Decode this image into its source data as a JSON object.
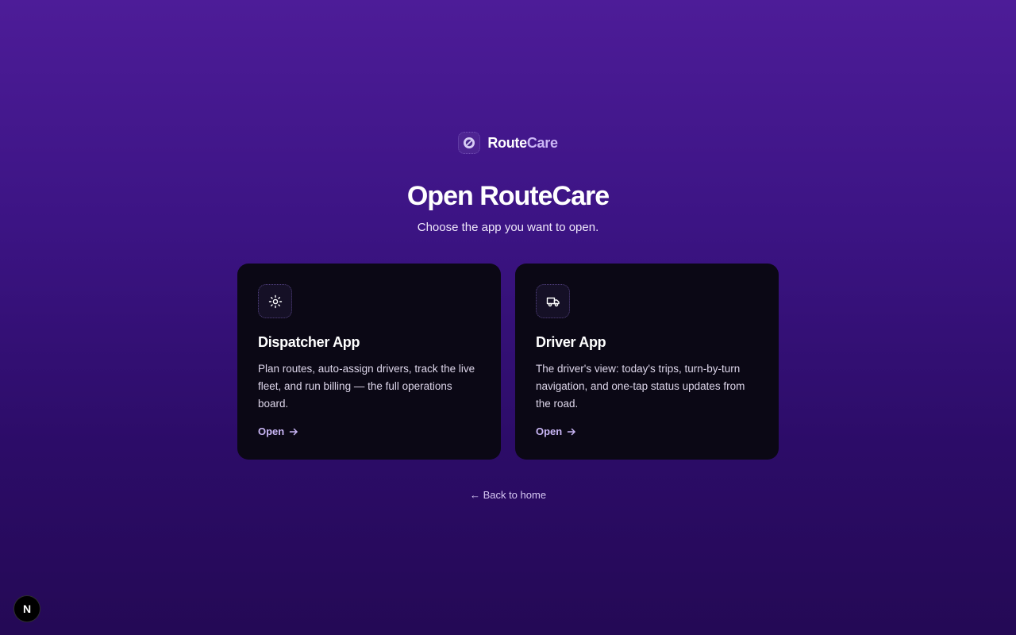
{
  "brand": {
    "logo_icon": "map-pin-shield-icon",
    "name_part1": "Route",
    "name_part2": "Care"
  },
  "page": {
    "title": "Open RouteCare",
    "subtitle": "Choose the app you want to open."
  },
  "cards": [
    {
      "icon": "sun-gear-icon",
      "title": "Dispatcher App",
      "description": "Plan routes, auto-assign drivers, track the live fleet, and run billing — the full operations board.",
      "link_label": "Open",
      "link_icon": "arrow-right-icon"
    },
    {
      "icon": "truck-icon",
      "title": "Driver App",
      "description": "The driver's view: today's trips, turn-by-turn navigation, and one-tap status updates from the road.",
      "link_label": "Open",
      "link_icon": "arrow-right-icon"
    }
  ],
  "back_link": {
    "arrow": "←",
    "label": "Back to home"
  },
  "dev_badge": {
    "label": "N"
  },
  "colors": {
    "background_top": "#4d1c98",
    "background_bottom": "#240955",
    "card_background": "#0b0815",
    "accent": "#c9b6f5"
  }
}
